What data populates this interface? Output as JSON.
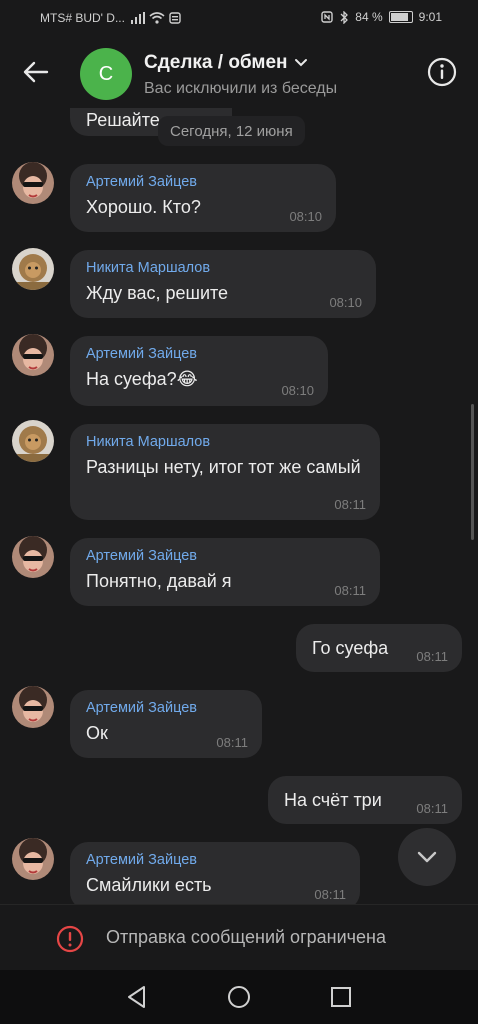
{
  "status_bar": {
    "carrier": "MTS# BUD' D...",
    "battery": "84 %",
    "time": "9:01"
  },
  "header": {
    "avatar_letter": "С",
    "title": "Сделка / обмен",
    "subtitle": "Вас исключили из беседы",
    "icons": [
      "back-arrow-icon",
      "chevron-down-icon",
      "info-icon"
    ],
    "colors": {
      "avatar": "#4bb34b",
      "author": "#71aaeb"
    }
  },
  "chat": {
    "partial_message": "Решайте",
    "date_separator": "Сегодня, 12 июня",
    "messages": [
      {
        "author": "Артемий Зайцев",
        "text": "Хорошо. Кто?",
        "time": "08:10"
      },
      {
        "author": "Никита Маршалов",
        "text": "Жду вас, решите",
        "time": "08:10"
      },
      {
        "author": "Артемий Зайцев",
        "text": "На суефа?😂",
        "time": "08:10"
      },
      {
        "author": "Никита Маршалов",
        "text": "Разницы нету, итог тот же самый",
        "time": "08:11"
      },
      {
        "author": "Артемий Зайцев",
        "text": "Понятно, давай я",
        "time": "08:11"
      },
      {
        "author": "",
        "text": "Го суефа",
        "time": "08:11"
      },
      {
        "author": "Артемий Зайцев",
        "text": "Ок",
        "time": "08:11"
      },
      {
        "author": "",
        "text": "На счёт три",
        "time": "08:11"
      },
      {
        "author": "Артемий Зайцев",
        "text": "Смайлики есть",
        "time": "08:11"
      }
    ]
  },
  "footer": {
    "restricted_text": "Отправка сообщений ограничена"
  }
}
